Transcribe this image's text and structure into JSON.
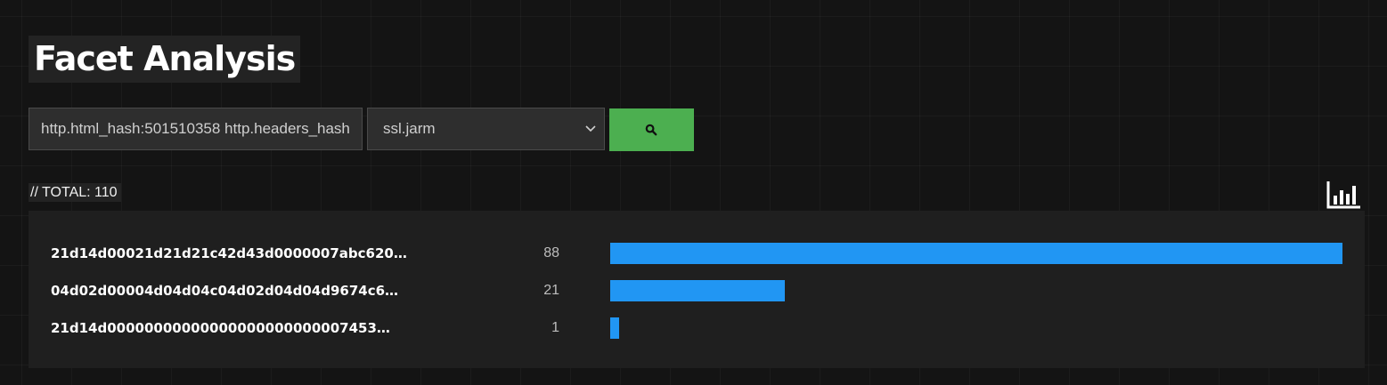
{
  "page": {
    "title": "Facet Analysis"
  },
  "search": {
    "query_value": "http.html_hash:501510358 http.headers_hash:",
    "facet_selected": "ssl.jarm",
    "button_icon": "search-icon"
  },
  "summary": {
    "total_label": "// TOTAL: 110",
    "chart_toggle_icon": "bar-chart-icon"
  },
  "colors": {
    "accent_green": "#4caf50",
    "bar_blue": "#2196f3",
    "panel_bg": "#1f1f1f",
    "page_bg": "#141414"
  },
  "facets": {
    "max_count": 88,
    "rows": [
      {
        "value": "21d14d00021d21d21c42d43d0000007abc620…",
        "count": "88",
        "count_num": 88
      },
      {
        "value": "04d02d00004d04d04c04d02d04d04d9674c6…",
        "count": "21",
        "count_num": 21
      },
      {
        "value": "21d14d00000000000000000000000007453…",
        "count": "1",
        "count_num": 1
      }
    ]
  }
}
